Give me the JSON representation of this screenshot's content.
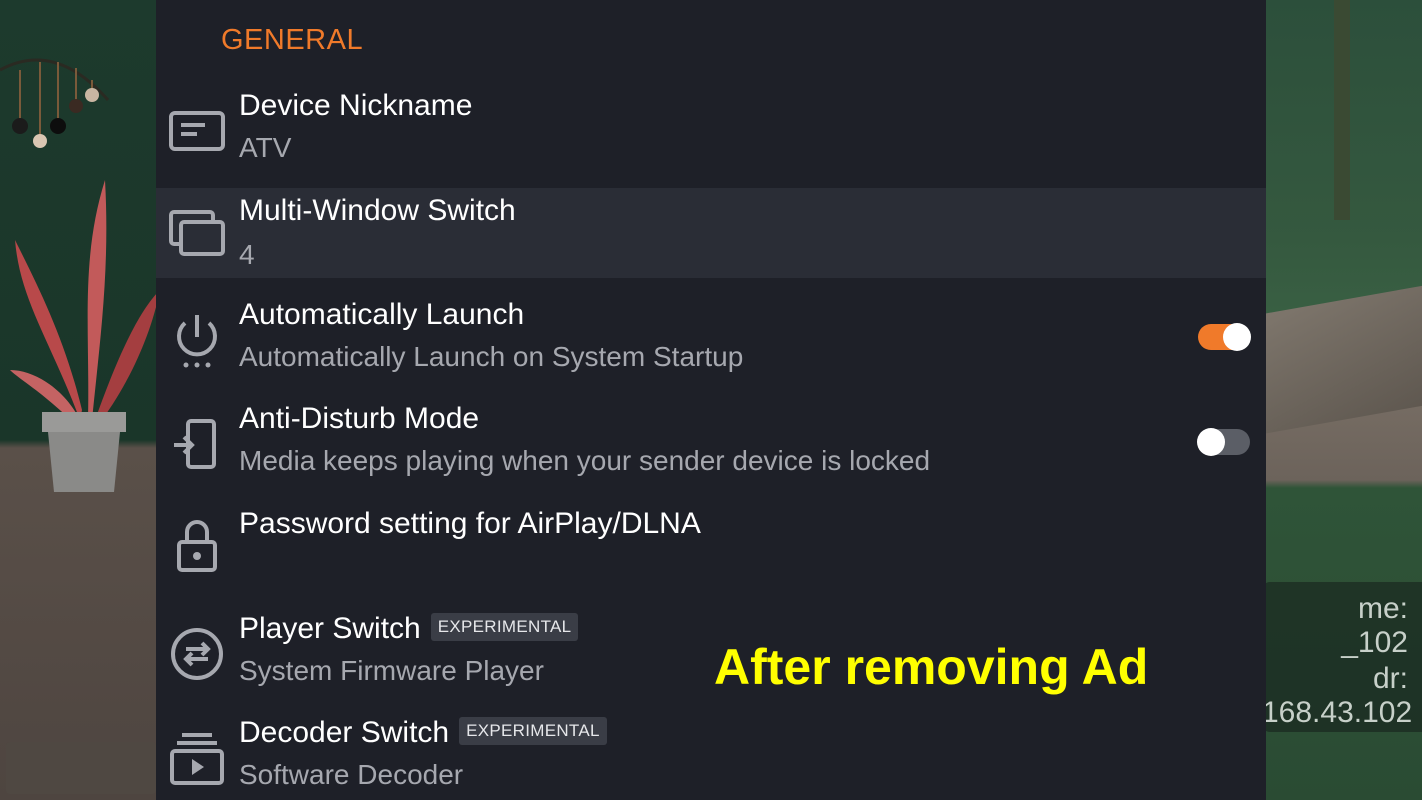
{
  "section": {
    "title": "GENERAL"
  },
  "colors": {
    "accent": "#f07a2a",
    "panel_bg": "#1e2028",
    "caption": "#ffff00"
  },
  "settings": [
    {
      "icon": "device-card-icon",
      "title": "Device Nickname",
      "subtitle": "ATV",
      "focused": false
    },
    {
      "icon": "multi-window-icon",
      "title": "Multi-Window Switch",
      "subtitle": "4",
      "focused": true
    },
    {
      "icon": "power-icon",
      "title": "Automatically Launch",
      "subtitle": "Automatically Launch on System Startup",
      "toggle": true
    },
    {
      "icon": "phone-lock-icon",
      "title": "Anti-Disturb Mode",
      "subtitle": "Media keeps playing when your sender device is locked",
      "toggle": false
    },
    {
      "icon": "lock-icon",
      "title": "Password setting for AirPlay/DLNA",
      "subtitle": ""
    },
    {
      "icon": "swap-arrows-icon",
      "title": "Player Switch",
      "badge": "EXPERIMENTAL",
      "subtitle": "System Firmware Player"
    },
    {
      "icon": "decoder-icon",
      "title": "Decoder Switch",
      "badge": "EXPERIMENTAL",
      "subtitle": "Software Decoder"
    }
  ],
  "overlay_caption": "After removing Ad",
  "background_info": {
    "line1": "me:",
    "line2": "_102",
    "line3": "dr:",
    "line4": "168.43.102"
  }
}
